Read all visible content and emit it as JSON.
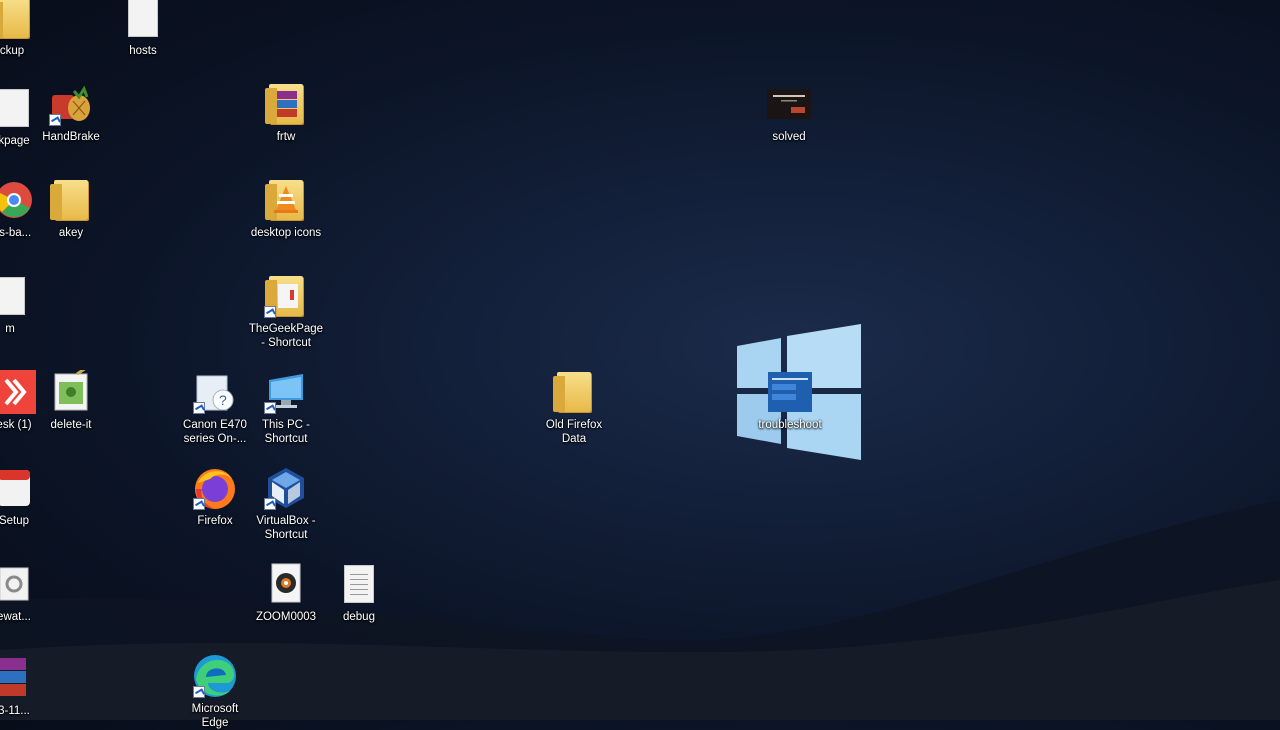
{
  "desktop": {
    "icons": [
      {
        "label": "ckup"
      },
      {
        "label": "hosts"
      },
      {
        "label": "kpage"
      },
      {
        "label": "HandBrake"
      },
      {
        "label": "frtw"
      },
      {
        "label": "solved"
      },
      {
        "label": "ls-ba..."
      },
      {
        "label": "akey"
      },
      {
        "label": "desktop icons"
      },
      {
        "label": "m"
      },
      {
        "label": "TheGeekPage - Shortcut"
      },
      {
        "label": "esk (1)"
      },
      {
        "label": "delete-it"
      },
      {
        "label": "Canon E470 series On-..."
      },
      {
        "label": "This PC - Shortcut"
      },
      {
        "label": "Old Firefox Data"
      },
      {
        "label": "troubleshoot"
      },
      {
        "label": "Setup"
      },
      {
        "label": "Firefox"
      },
      {
        "label": "VirtualBox - Shortcut"
      },
      {
        "label": "ewat..."
      },
      {
        "label": "ZOOM0003"
      },
      {
        "label": "debug"
      },
      {
        "label": "3-11..."
      },
      {
        "label": "Microsoft Edge"
      }
    ]
  }
}
